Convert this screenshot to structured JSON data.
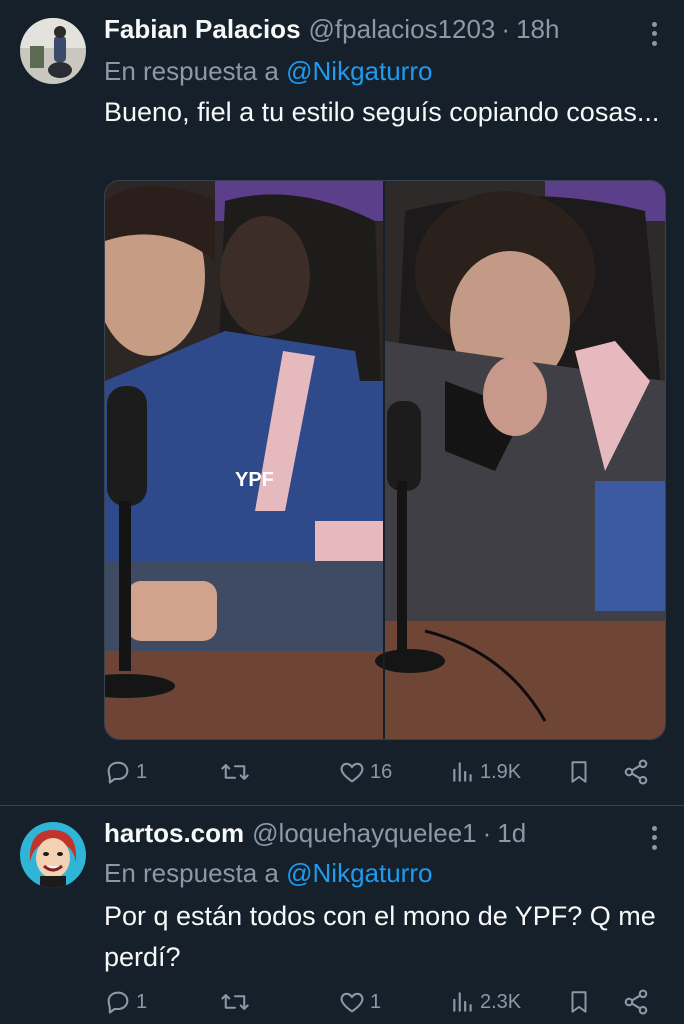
{
  "tweets": [
    {
      "name": "Fabian Palacios",
      "handle": "@fpalacios1203",
      "separator": "·",
      "time": "18h",
      "reply_prefix": "En respuesta a",
      "reply_to": "@Nikgaturro",
      "text": "Bueno, fiel a tu estilo seguís copiando cosas...",
      "media_caption": "YPF",
      "stats": {
        "replies": "1",
        "retweets": "",
        "likes": "16",
        "views": "1.9K"
      }
    },
    {
      "name": "hartos.com",
      "handle": "@loquehayquelee1",
      "separator": "·",
      "time": "1d",
      "reply_prefix": "En respuesta a",
      "reply_to": "@Nikgaturro",
      "text": "Por q están todos con el mono de YPF? Q me perdí?",
      "stats": {
        "replies": "1",
        "retweets": "",
        "likes": "1",
        "views": "2.3K"
      }
    }
  ],
  "colors": {
    "background": "#15202b",
    "text": "#f7f9f9",
    "muted": "#8b98a5",
    "link": "#1d9bf0",
    "border": "#38444d"
  },
  "icons": [
    "more-icon",
    "reply-icon",
    "retweet-icon",
    "like-icon",
    "views-icon",
    "bookmark-icon",
    "share-icon"
  ]
}
